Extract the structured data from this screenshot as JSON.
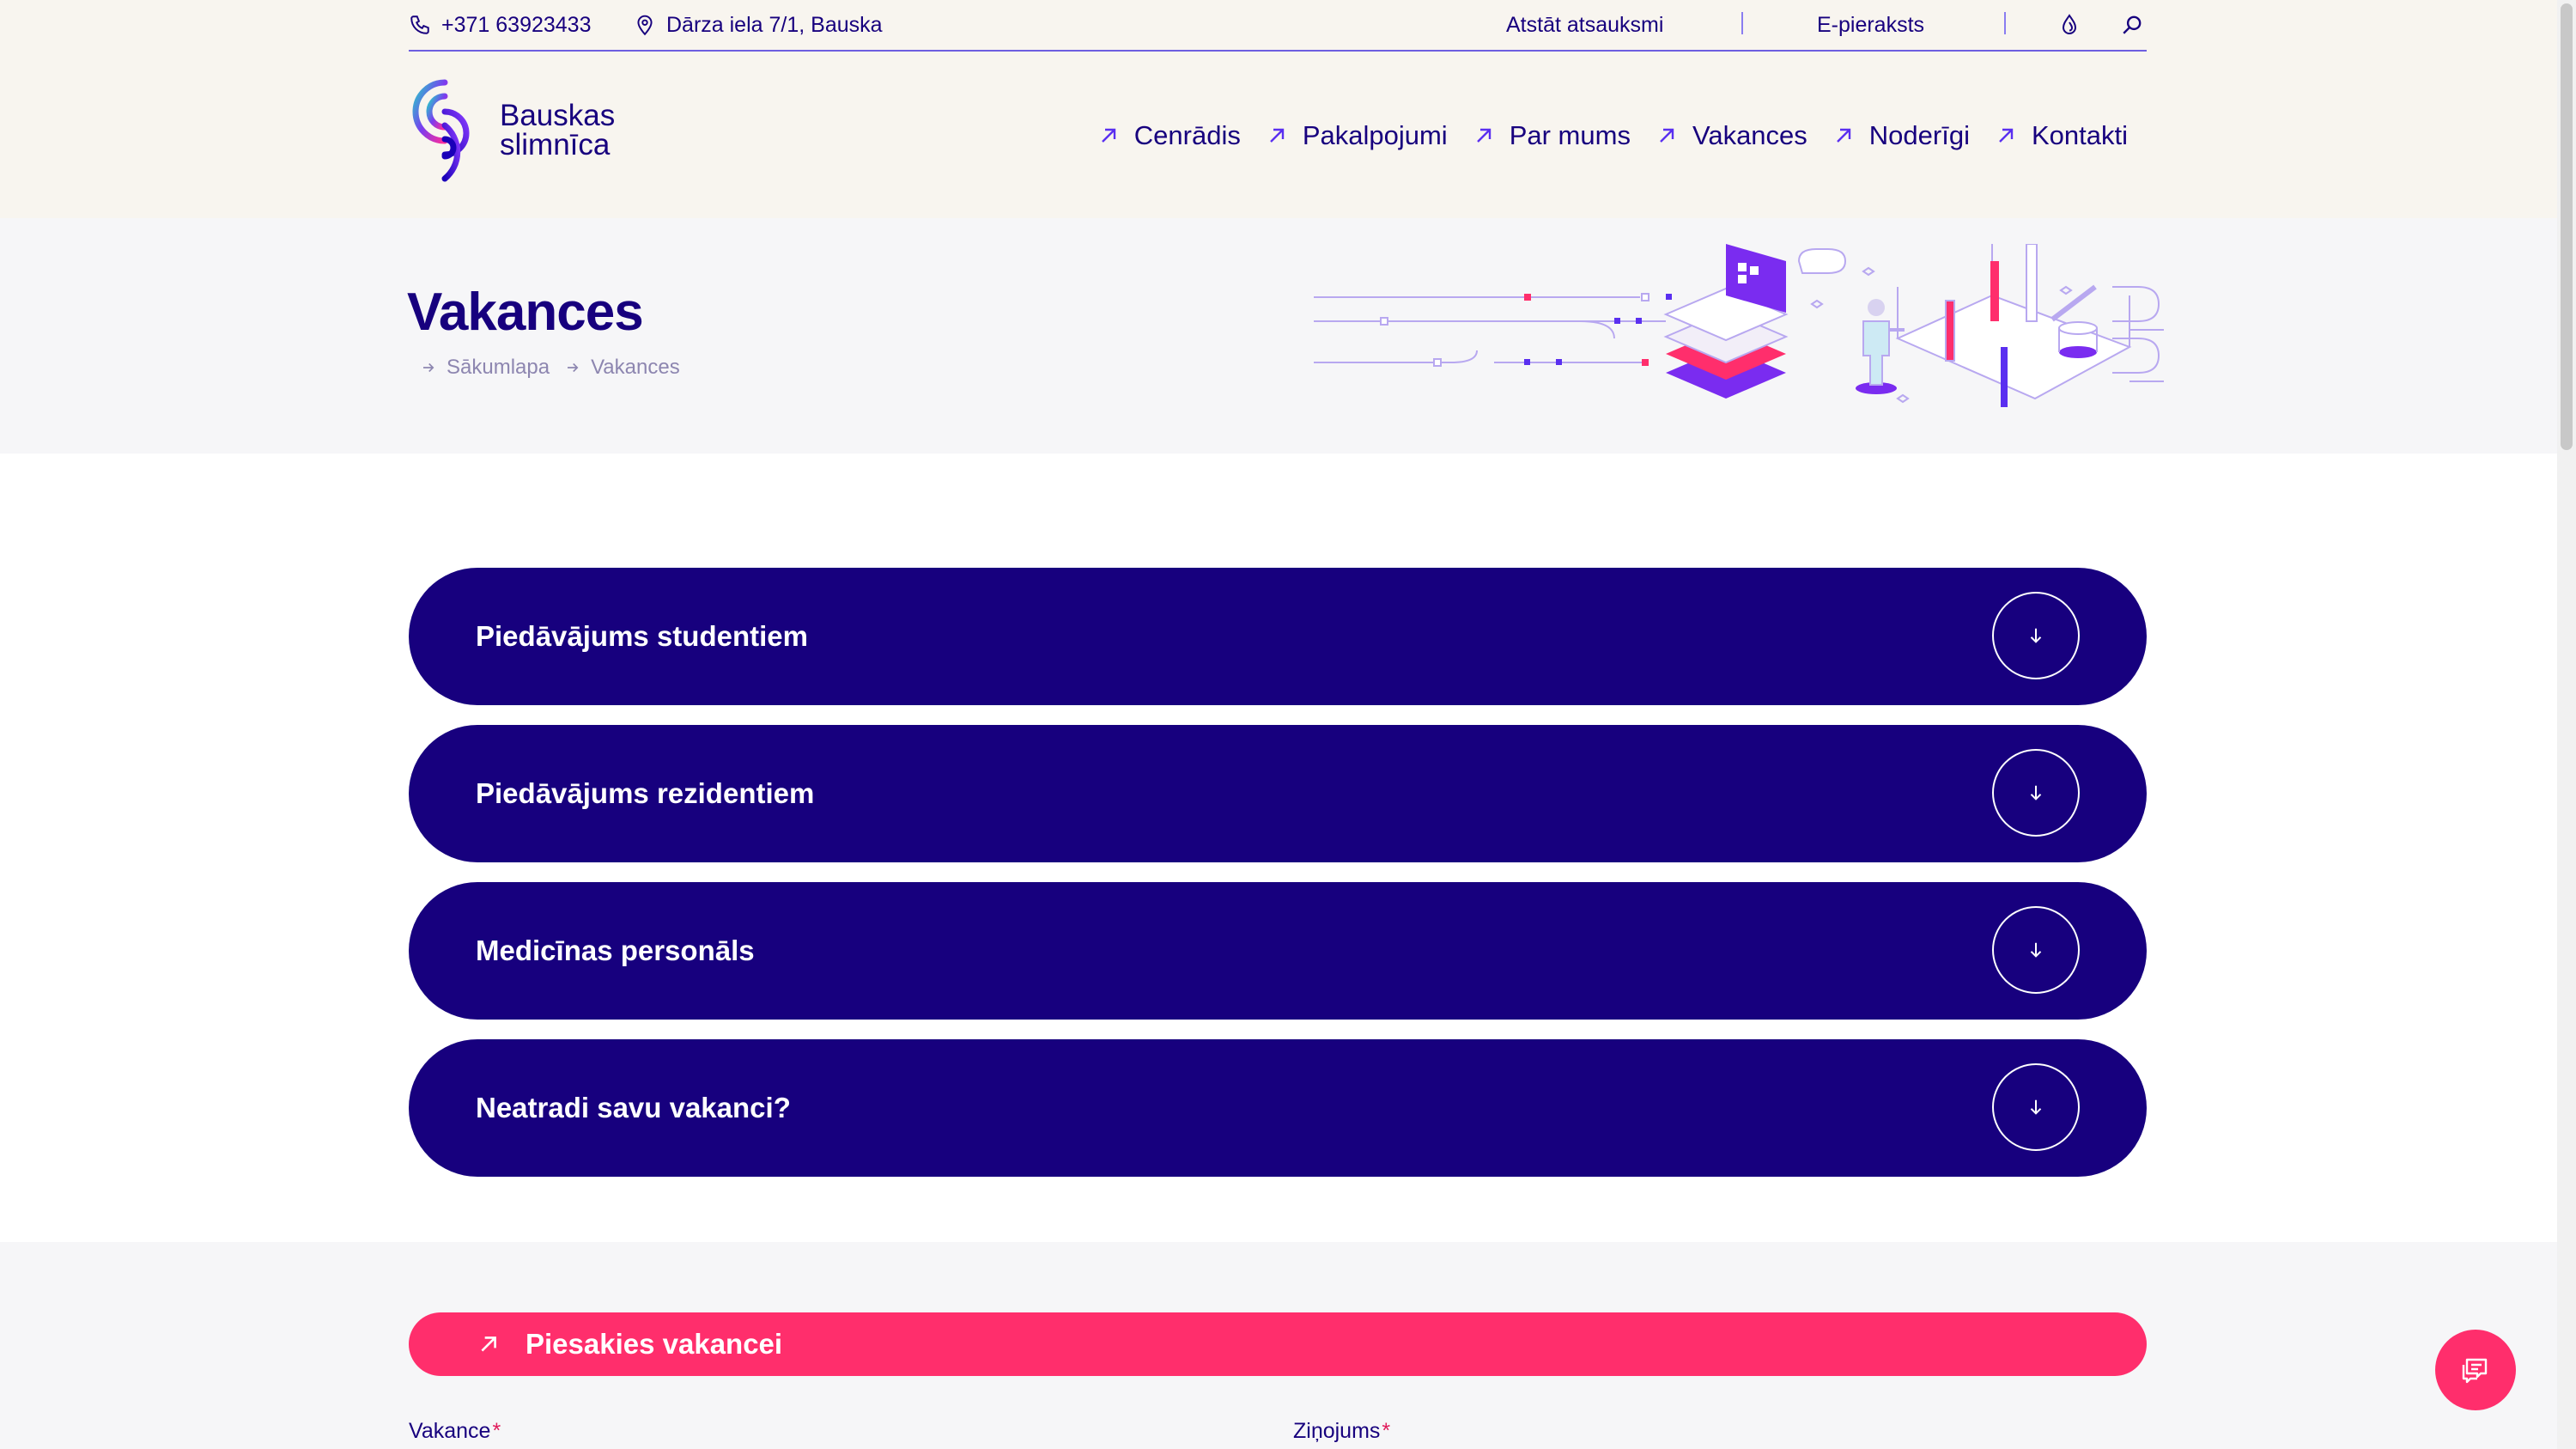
{
  "topbar": {
    "phone": "+371 63923433",
    "address": "Dārza iela 7/1, Bauska",
    "feedback": "Atstāt atsauksmi",
    "booking": "E-pieraksts",
    "icons": [
      "drop-icon",
      "search-icon"
    ]
  },
  "logo": {
    "line1": "Bauskas",
    "line2": "slimnīca"
  },
  "nav": {
    "items": [
      {
        "label": "Cenrādis"
      },
      {
        "label": "Pakalpojumi"
      },
      {
        "label": "Par mums"
      },
      {
        "label": "Vakances"
      },
      {
        "label": "Noderīgi"
      },
      {
        "label": "Kontakti"
      }
    ]
  },
  "hero": {
    "title": "Vakances",
    "breadcrumb": [
      "Sākumlapa",
      "Vakances"
    ]
  },
  "accordion": [
    {
      "label": "Piedāvājums studentiem"
    },
    {
      "label": "Piedāvājums rezidentiem"
    },
    {
      "label": "Medicīnas personāls"
    },
    {
      "label": "Neatradi savu vakanci?"
    }
  ],
  "form": {
    "apply_label": "Piesakies vakancei",
    "vacancy_label": "Vakance",
    "message_label": "Ziņojums",
    "required_mark": "*"
  },
  "colors": {
    "brand": "#17007e",
    "accent": "#ff2e6c",
    "header_bg": "#f8f5ef",
    "hero_bg": "#f6f6f8"
  }
}
